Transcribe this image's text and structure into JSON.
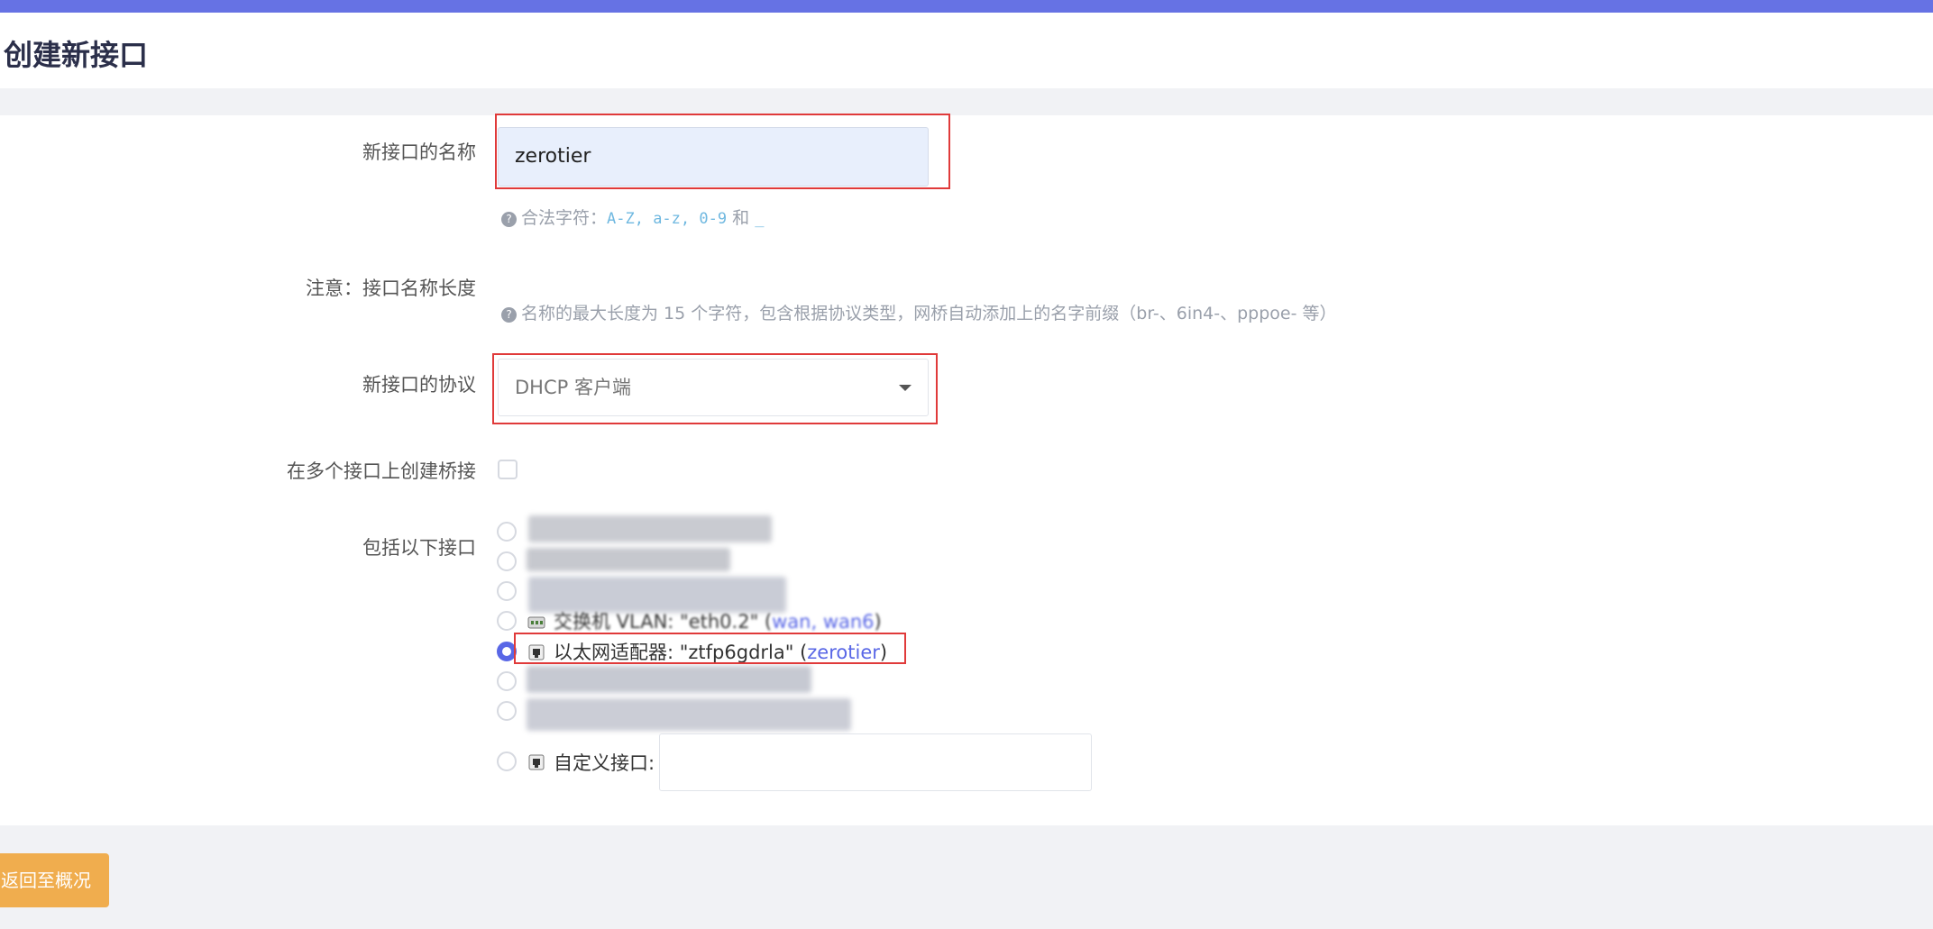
{
  "page": {
    "title": "创建新接口"
  },
  "form": {
    "name_label": "新接口的名称",
    "name_value": "zerotier",
    "name_hint_prefix": "合法字符：",
    "name_hint_chars": "A-Z, a-z, 0-9",
    "name_hint_and": "和",
    "name_hint_underscore": "_",
    "note_label": "注意：接口名称长度",
    "note_hint": "名称的最大长度为 15 个字符，包含根据协议类型，网桥自动添加上的名字前缀（br-、6in4-、pppoe- 等）",
    "protocol_label": "新接口的协议",
    "protocol_value": "DHCP 客户端",
    "bridge_label": "在多个接口上创建桥接",
    "include_label": "包括以下接口"
  },
  "interfaces": {
    "vlan_line_text": "交换机 VLAN: \"eth0.2\" (",
    "vlan_line_link": "wan, wan6",
    "vlan_line_close": ")",
    "selected_text": "以太网适配器: \"ztfp6gdrla\" (",
    "selected_link": "zerotier",
    "selected_close": ")",
    "custom_label": "自定义接口:"
  },
  "actions": {
    "back_label": "返回至概况"
  },
  "colors": {
    "accent": "#6672e4",
    "back_button": "#f0ad4e",
    "highlight": "#e03a3a",
    "link": "#5967e6"
  }
}
